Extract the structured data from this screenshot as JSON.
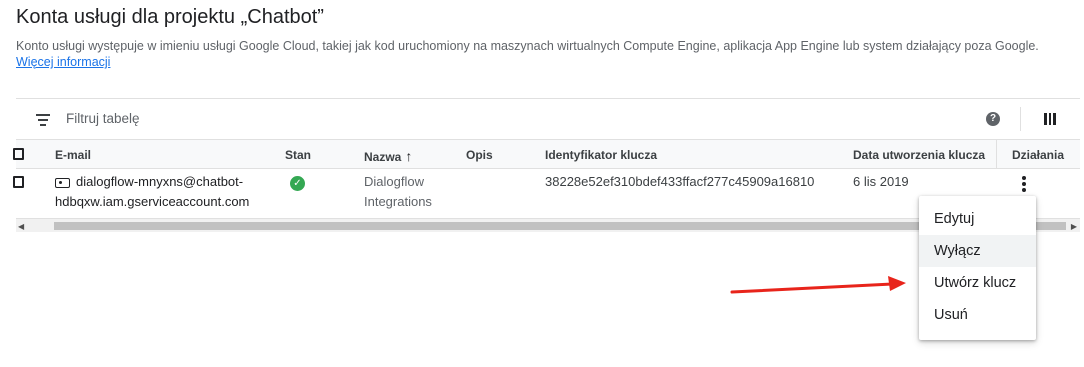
{
  "page": {
    "title": "Konta usługi dla projektu „Chatbot”",
    "description": "Konto usługi występuje w imieniu usługi Google Cloud, takiej jak kod uruchomiony na maszynach wirtualnych Compute Engine, aplikacja App Engine lub system działający poza Google.",
    "more_link": "Więcej informacji"
  },
  "toolbar": {
    "filter_placeholder": "Filtruj tabelę",
    "filter_icon": "filter-list-icon",
    "help_icon": "help-icon",
    "columns_icon": "column-display-icon"
  },
  "table": {
    "columns": [
      "E-mail",
      "Stan",
      "Nazwa",
      "Opis",
      "Identyfikator klucza",
      "Data utworzenia klucza",
      "Działania"
    ],
    "sort_indicator": "↑",
    "rows": [
      {
        "email_line1": "dialogflow-mnyxns@chatbot-",
        "email_line2": "hdbqxw.iam.gserviceaccount.com",
        "status": "✓",
        "status_icon": "check-circle-icon",
        "name_line1": "Dialogflow",
        "name_line2": "Integrations",
        "description": "",
        "key_id": "38228e52ef310bdef433ffacf277c45909a16810",
        "key_created": "6 lis 2019"
      }
    ]
  },
  "scrollbar": {
    "left_arrow": "◀",
    "right_arrow": "▶"
  },
  "context_menu": {
    "items": [
      "Edytuj",
      "Wyłącz",
      "Utwórz klucz",
      "Usuń"
    ],
    "highlighted": "Wyłącz"
  },
  "colors": {
    "link": "#1a73e8",
    "status_ok": "#34a853",
    "annotation_arrow": "#e8241b"
  }
}
